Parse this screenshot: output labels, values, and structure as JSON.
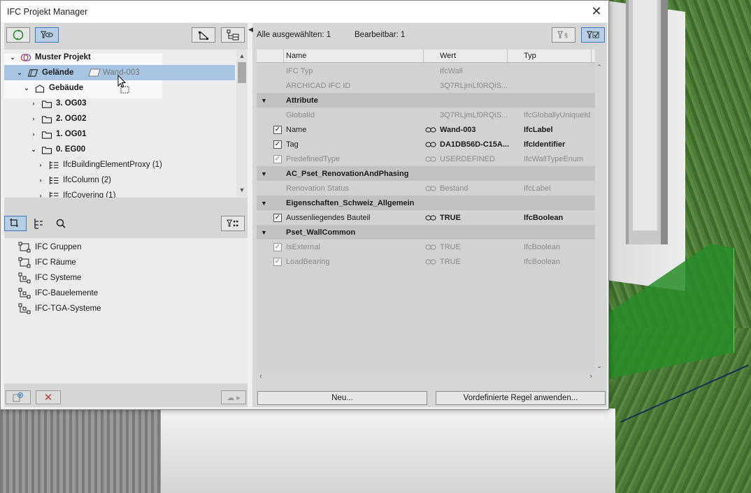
{
  "window": {
    "title": "IFC Projekt Manager"
  },
  "tree": {
    "root": "Muster Projekt",
    "site": "Gelände",
    "building": "Gebäude",
    "storeys": [
      "3. OG03",
      "2. OG02",
      "1. OG01",
      "0. EG00"
    ],
    "children": [
      "IfcBuildingElementProxy (1)",
      "IfcColumn (2)",
      "IfcCovering (1)"
    ],
    "drag_item": "Wand-003"
  },
  "groups": {
    "items": [
      "IFC Gruppen",
      "IFC Räume",
      "IFC Systeme",
      "IFC-Bauelemente",
      "IFC-TGA-Systeme"
    ]
  },
  "properties": {
    "selected_label": "Alle ausgewählten: 1",
    "editable_label": "Bearbeitbar: 1",
    "columns": {
      "name": "Name",
      "value": "Wert",
      "type": "Typ"
    },
    "rows": [
      {
        "kind": "prop",
        "name": "IFC Typ",
        "value": "IfcWall",
        "type": "",
        "check": "none",
        "link": false,
        "style": "dim"
      },
      {
        "kind": "prop",
        "name": "ARCHICAD IFC ID",
        "value": "3Q7RLjmLf0RQiS...",
        "type": "",
        "check": "none",
        "link": false,
        "style": "dim"
      },
      {
        "kind": "group",
        "name": "Attribute"
      },
      {
        "kind": "prop",
        "name": "GlobalId",
        "value": "3Q7RLjmLf0RQiS...",
        "type": "IfcGloballyUniqueId",
        "check": "none",
        "link": false,
        "style": "dim"
      },
      {
        "kind": "prop",
        "name": "Name",
        "value": "Wand-003",
        "type": "IfcLabel",
        "check": "on",
        "link": true,
        "style": "normal"
      },
      {
        "kind": "prop",
        "name": "Tag",
        "value": "DA1DB56D-C15A...",
        "type": "IfcIdentifier",
        "check": "on",
        "link": true,
        "style": "normal"
      },
      {
        "kind": "prop",
        "name": "PredefinedType",
        "value": "USERDEFINED",
        "type": "IfcWallTypeEnum",
        "check": "dim",
        "link": true,
        "style": "dim"
      },
      {
        "kind": "group",
        "name": "AC_Pset_RenovationAndPhasing"
      },
      {
        "kind": "prop",
        "name": "Renovation Status",
        "value": "Bestand",
        "type": "IfcLabel",
        "check": "none",
        "link": true,
        "style": "dim"
      },
      {
        "kind": "group",
        "name": "Eigenschaften_Schweiz_Allgemein"
      },
      {
        "kind": "prop",
        "name": "Aussenliegendes Bauteil",
        "value": "TRUE",
        "type": "IfcBoolean",
        "check": "on",
        "link": true,
        "style": "normal"
      },
      {
        "kind": "group",
        "name": "Pset_WallCommon"
      },
      {
        "kind": "prop",
        "name": "IsExternal",
        "value": "TRUE",
        "type": "IfcBoolean",
        "check": "dim",
        "link": true,
        "style": "dim"
      },
      {
        "kind": "prop",
        "name": "LoadBearing",
        "value": "TRUE",
        "type": "IfcBoolean",
        "check": "dim",
        "link": true,
        "style": "dim"
      }
    ],
    "new_button": "Neu...",
    "rule_button": "Vordefinierte Regel anwenden..."
  }
}
